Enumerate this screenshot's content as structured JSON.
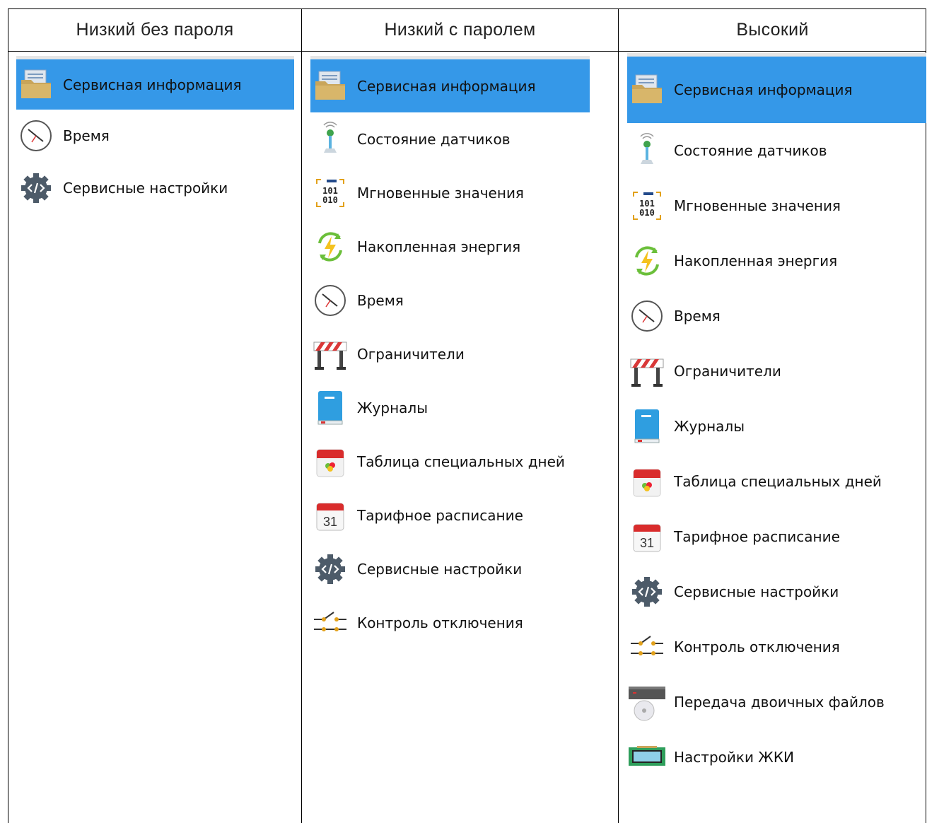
{
  "columns": [
    {
      "header": "Низкий без пароля",
      "items": [
        {
          "label": "Сервисная информация",
          "icon": "folder-icon",
          "selected": true
        },
        {
          "label": "Время",
          "icon": "clock-icon"
        },
        {
          "label": "Сервисные настройки",
          "icon": "gear-code-icon"
        }
      ]
    },
    {
      "header": "Низкий с паролем",
      "items": [
        {
          "label": "Сервисная информация",
          "icon": "folder-icon",
          "selected": true
        },
        {
          "label": "Состояние датчиков",
          "icon": "sensor-icon"
        },
        {
          "label": "Мгновенные значения",
          "icon": "binary-icon"
        },
        {
          "label": "Накопленная энергия",
          "icon": "energy-icon"
        },
        {
          "label": "Время",
          "icon": "clock-icon"
        },
        {
          "label": "Ограничители",
          "icon": "barrier-icon"
        },
        {
          "label": "Журналы",
          "icon": "book-icon"
        },
        {
          "label": "Таблица специальных дней",
          "icon": "calendar-balloons-icon"
        },
        {
          "label": "Тарифное расписание",
          "icon": "calendar-31-icon"
        },
        {
          "label": "Сервисные настройки",
          "icon": "gear-code-icon"
        },
        {
          "label": "Контроль отключения",
          "icon": "switch-icon"
        }
      ]
    },
    {
      "header": "Высокий",
      "items": [
        {
          "label": "Сервисная информация",
          "icon": "folder-icon",
          "selected": true
        },
        {
          "label": "Состояние датчиков",
          "icon": "sensor-icon"
        },
        {
          "label": "Мгновенные значения",
          "icon": "binary-icon"
        },
        {
          "label": "Накопленная энергия",
          "icon": "energy-icon"
        },
        {
          "label": "Время",
          "icon": "clock-icon"
        },
        {
          "label": "Ограничители",
          "icon": "barrier-icon"
        },
        {
          "label": "Журналы",
          "icon": "book-icon"
        },
        {
          "label": "Таблица специальных дней",
          "icon": "calendar-balloons-icon"
        },
        {
          "label": "Тарифное расписание",
          "icon": "calendar-31-icon"
        },
        {
          "label": "Сервисные настройки",
          "icon": "gear-code-icon"
        },
        {
          "label": "Контроль отключения",
          "icon": "switch-icon"
        },
        {
          "label": "Передача двоичных файлов",
          "icon": "disk-drive-icon"
        },
        {
          "label": "Настройки ЖКИ",
          "icon": "lcd-icon"
        }
      ]
    }
  ],
  "icon_text": {
    "binary": "101 010",
    "calendar_day": "31"
  },
  "colors": {
    "selection": "#3598e8"
  }
}
